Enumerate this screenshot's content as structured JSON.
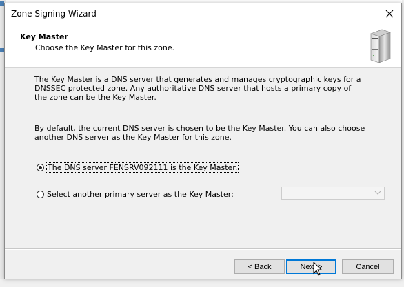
{
  "window": {
    "title": "Zone Signing Wizard"
  },
  "header": {
    "title": "Key Master",
    "subtitle": "Choose the Key Master for this zone.",
    "icon": "server-icon"
  },
  "body": {
    "paragraph1": "The Key Master is a DNS server that generates and manages cryptographic keys for a DNSSEC protected zone. Any authoritative DNS server that hosts a primary copy of the zone can be the Key Master.",
    "paragraph2": "By default, the current DNS server is chosen to be the Key Master. You can also choose another DNS server as the Key Master for this zone.",
    "options": [
      {
        "label": "The DNS server FENSRV092111 is the Key Master.",
        "selected": true
      },
      {
        "label": "Select another primary server as the Key Master:",
        "selected": false
      }
    ],
    "server_select": {
      "value": "",
      "enabled": false
    }
  },
  "buttons": {
    "back": "< Back",
    "next": "Next >",
    "cancel": "Cancel"
  },
  "colors": {
    "accent": "#0078d7",
    "dialog_bg": "#f0f0f0",
    "header_bg": "#ffffff"
  }
}
